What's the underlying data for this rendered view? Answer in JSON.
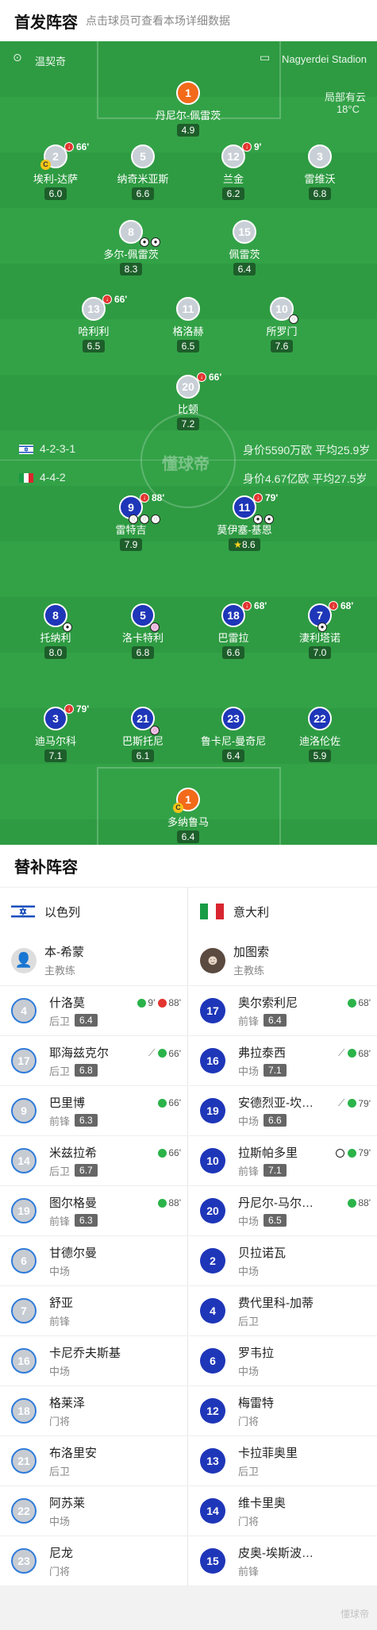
{
  "header": {
    "title": "首发阵容",
    "subtitle": "点击球员可查看本场详细数据"
  },
  "match": {
    "referee": "温契奇",
    "stadium": "Nagyerdei Stadion",
    "weather": "局部有云",
    "temperature": "18°C",
    "watermark": "懂球帝"
  },
  "israel": {
    "flag": "israel-flag-icon",
    "formation": "4-2-3-1",
    "value": "身价5590万欧",
    "age": "平均25.9岁",
    "players": [
      {
        "num": "1",
        "name": "丹尼尔-佩雷茨",
        "rating": "4.9",
        "gk": true
      },
      {
        "num": "2",
        "name": "埃利-达萨",
        "rating": "6.0",
        "sub": "66'",
        "captain": "C"
      },
      {
        "num": "5",
        "name": "纳奇米亚斯",
        "rating": "6.6"
      },
      {
        "num": "12",
        "name": "兰金",
        "rating": "6.2",
        "sub": "9'"
      },
      {
        "num": "3",
        "name": "雷维沃",
        "rating": "6.8"
      },
      {
        "num": "8",
        "name": "多尔-佩雷茨",
        "rating": "8.3"
      },
      {
        "num": "15",
        "name": "佩雷茨",
        "rating": "6.4"
      },
      {
        "num": "13",
        "name": "哈利利",
        "rating": "6.5",
        "sub": "66'"
      },
      {
        "num": "11",
        "name": "格洛赫",
        "rating": "6.5"
      },
      {
        "num": "10",
        "name": "所罗门",
        "rating": "7.6"
      },
      {
        "num": "20",
        "name": "比顿",
        "rating": "7.2",
        "sub": "66'"
      }
    ]
  },
  "italy": {
    "flag": "italy-flag-icon",
    "formation": "4-4-2",
    "value": "身价4.67亿欧",
    "age": "平均27.5岁",
    "players": [
      {
        "num": "9",
        "name": "雷特吉",
        "rating": "7.9",
        "sub": "88'"
      },
      {
        "num": "11",
        "name": "莫伊塞-基恩",
        "rating": "8.6",
        "sub": "79'"
      },
      {
        "num": "8",
        "name": "托纳利",
        "rating": "8.0"
      },
      {
        "num": "5",
        "name": "洛卡特利",
        "rating": "6.8"
      },
      {
        "num": "18",
        "name": "巴雷拉",
        "rating": "6.6",
        "sub": "68'"
      },
      {
        "num": "7",
        "name": "淒利塔诺",
        "rating": "7.0",
        "sub": "68'"
      },
      {
        "num": "3",
        "name": "迪马尔科",
        "rating": "7.1",
        "sub": "79'"
      },
      {
        "num": "21",
        "name": "巴斯托尼",
        "rating": "6.1"
      },
      {
        "num": "23",
        "name": "鲁卡尼-曼奇尼",
        "rating": "6.4"
      },
      {
        "num": "22",
        "name": "迪洛伦佐",
        "rating": "5.9"
      },
      {
        "num": "1",
        "name": "多纳鲁马",
        "rating": "6.4",
        "gk": true,
        "captain": "C"
      }
    ]
  },
  "subs": {
    "title": "替补阵容",
    "left_team": "以色列",
    "right_team": "意大利",
    "left_coach": {
      "name": "本-希蒙",
      "role": "主教练"
    },
    "right_coach": {
      "name": "加图索",
      "role": "主教练"
    },
    "left": [
      {
        "num": "4",
        "name": "什洛莫",
        "pos": "后卫",
        "rating": "6.4",
        "in": "9'",
        "out": "88'"
      },
      {
        "num": "17",
        "name": "耶海兹克尔",
        "pos": "后卫",
        "rating": "6.8",
        "in": "66'",
        "assist": true
      },
      {
        "num": "9",
        "name": "巴里博",
        "pos": "前锋",
        "rating": "6.3",
        "in": "66'"
      },
      {
        "num": "14",
        "name": "米兹拉希",
        "pos": "后卫",
        "rating": "6.7",
        "in": "66'"
      },
      {
        "num": "19",
        "name": "图尔格曼",
        "pos": "前锋",
        "rating": "6.3",
        "in": "88'"
      },
      {
        "num": "6",
        "name": "甘德尔曼",
        "pos": "中场"
      },
      {
        "num": "7",
        "name": "舒亚",
        "pos": "前锋"
      },
      {
        "num": "16",
        "name": "卡尼乔夫斯基",
        "pos": "中场"
      },
      {
        "num": "18",
        "name": "格莱泽",
        "pos": "门将"
      },
      {
        "num": "21",
        "name": "布洛里安",
        "pos": "后卫"
      },
      {
        "num": "22",
        "name": "阿苏莱",
        "pos": "中场"
      },
      {
        "num": "23",
        "name": "尼龙",
        "pos": "门将"
      }
    ],
    "right": [
      {
        "num": "17",
        "name": "奥尔索利尼",
        "pos": "前锋",
        "rating": "6.4",
        "in": "68'"
      },
      {
        "num": "16",
        "name": "弗拉泰西",
        "pos": "中场",
        "rating": "7.1",
        "in": "68'",
        "assist": true
      },
      {
        "num": "19",
        "name": "安德烈亚-坎…",
        "pos": "中场",
        "rating": "6.6",
        "in": "79'",
        "assist": true
      },
      {
        "num": "10",
        "name": "拉斯帕多里",
        "pos": "前锋",
        "rating": "7.1",
        "in": "79'",
        "goal": true
      },
      {
        "num": "20",
        "name": "丹尼尔-马尔…",
        "pos": "中场",
        "rating": "6.5",
        "in": "88'"
      },
      {
        "num": "2",
        "name": "贝拉诺瓦",
        "pos": "中场"
      },
      {
        "num": "4",
        "name": "费代里科-加蒂",
        "pos": "后卫"
      },
      {
        "num": "6",
        "name": "罗韦拉",
        "pos": "中场"
      },
      {
        "num": "12",
        "name": "梅雷特",
        "pos": "门将"
      },
      {
        "num": "13",
        "name": "卡拉菲奥里",
        "pos": "后卫"
      },
      {
        "num": "14",
        "name": "维卡里奥",
        "pos": "门将"
      },
      {
        "num": "15",
        "name": "皮奥-埃斯波…",
        "pos": "前锋"
      }
    ]
  }
}
